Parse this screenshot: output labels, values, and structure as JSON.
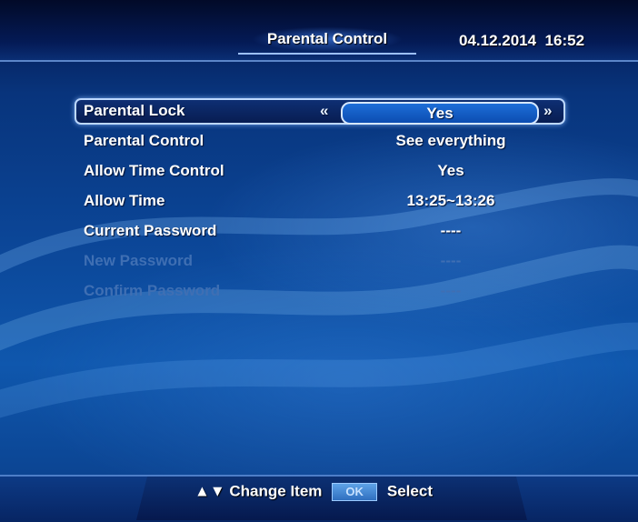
{
  "header": {
    "title": "Parental Control",
    "date": "04.12.2014",
    "time": "16:52"
  },
  "menu": {
    "items": [
      {
        "label": "Parental Lock",
        "value": "Yes",
        "selected": true,
        "enabled": true
      },
      {
        "label": "Parental Control",
        "value": "See everything",
        "selected": false,
        "enabled": true
      },
      {
        "label": "Allow Time Control",
        "value": "Yes",
        "selected": false,
        "enabled": true
      },
      {
        "label": "Allow Time",
        "value": "13:25~13:26",
        "selected": false,
        "enabled": true
      },
      {
        "label": "Current Password",
        "value": "----",
        "selected": false,
        "enabled": true
      },
      {
        "label": "New Password",
        "value": "----",
        "selected": false,
        "enabled": false
      },
      {
        "label": "Confirm Password",
        "value": "----",
        "selected": false,
        "enabled": false
      }
    ],
    "left_arrow": "«",
    "right_arrow": "»"
  },
  "footer": {
    "nav_arrows": "▲▼",
    "change_label": "Change Item",
    "ok_key": "OK",
    "select_label": "Select"
  },
  "colors": {
    "background": "#0b4596",
    "disabled_text": "#3f6fb3",
    "highlight_border": "#bcd8ff"
  }
}
